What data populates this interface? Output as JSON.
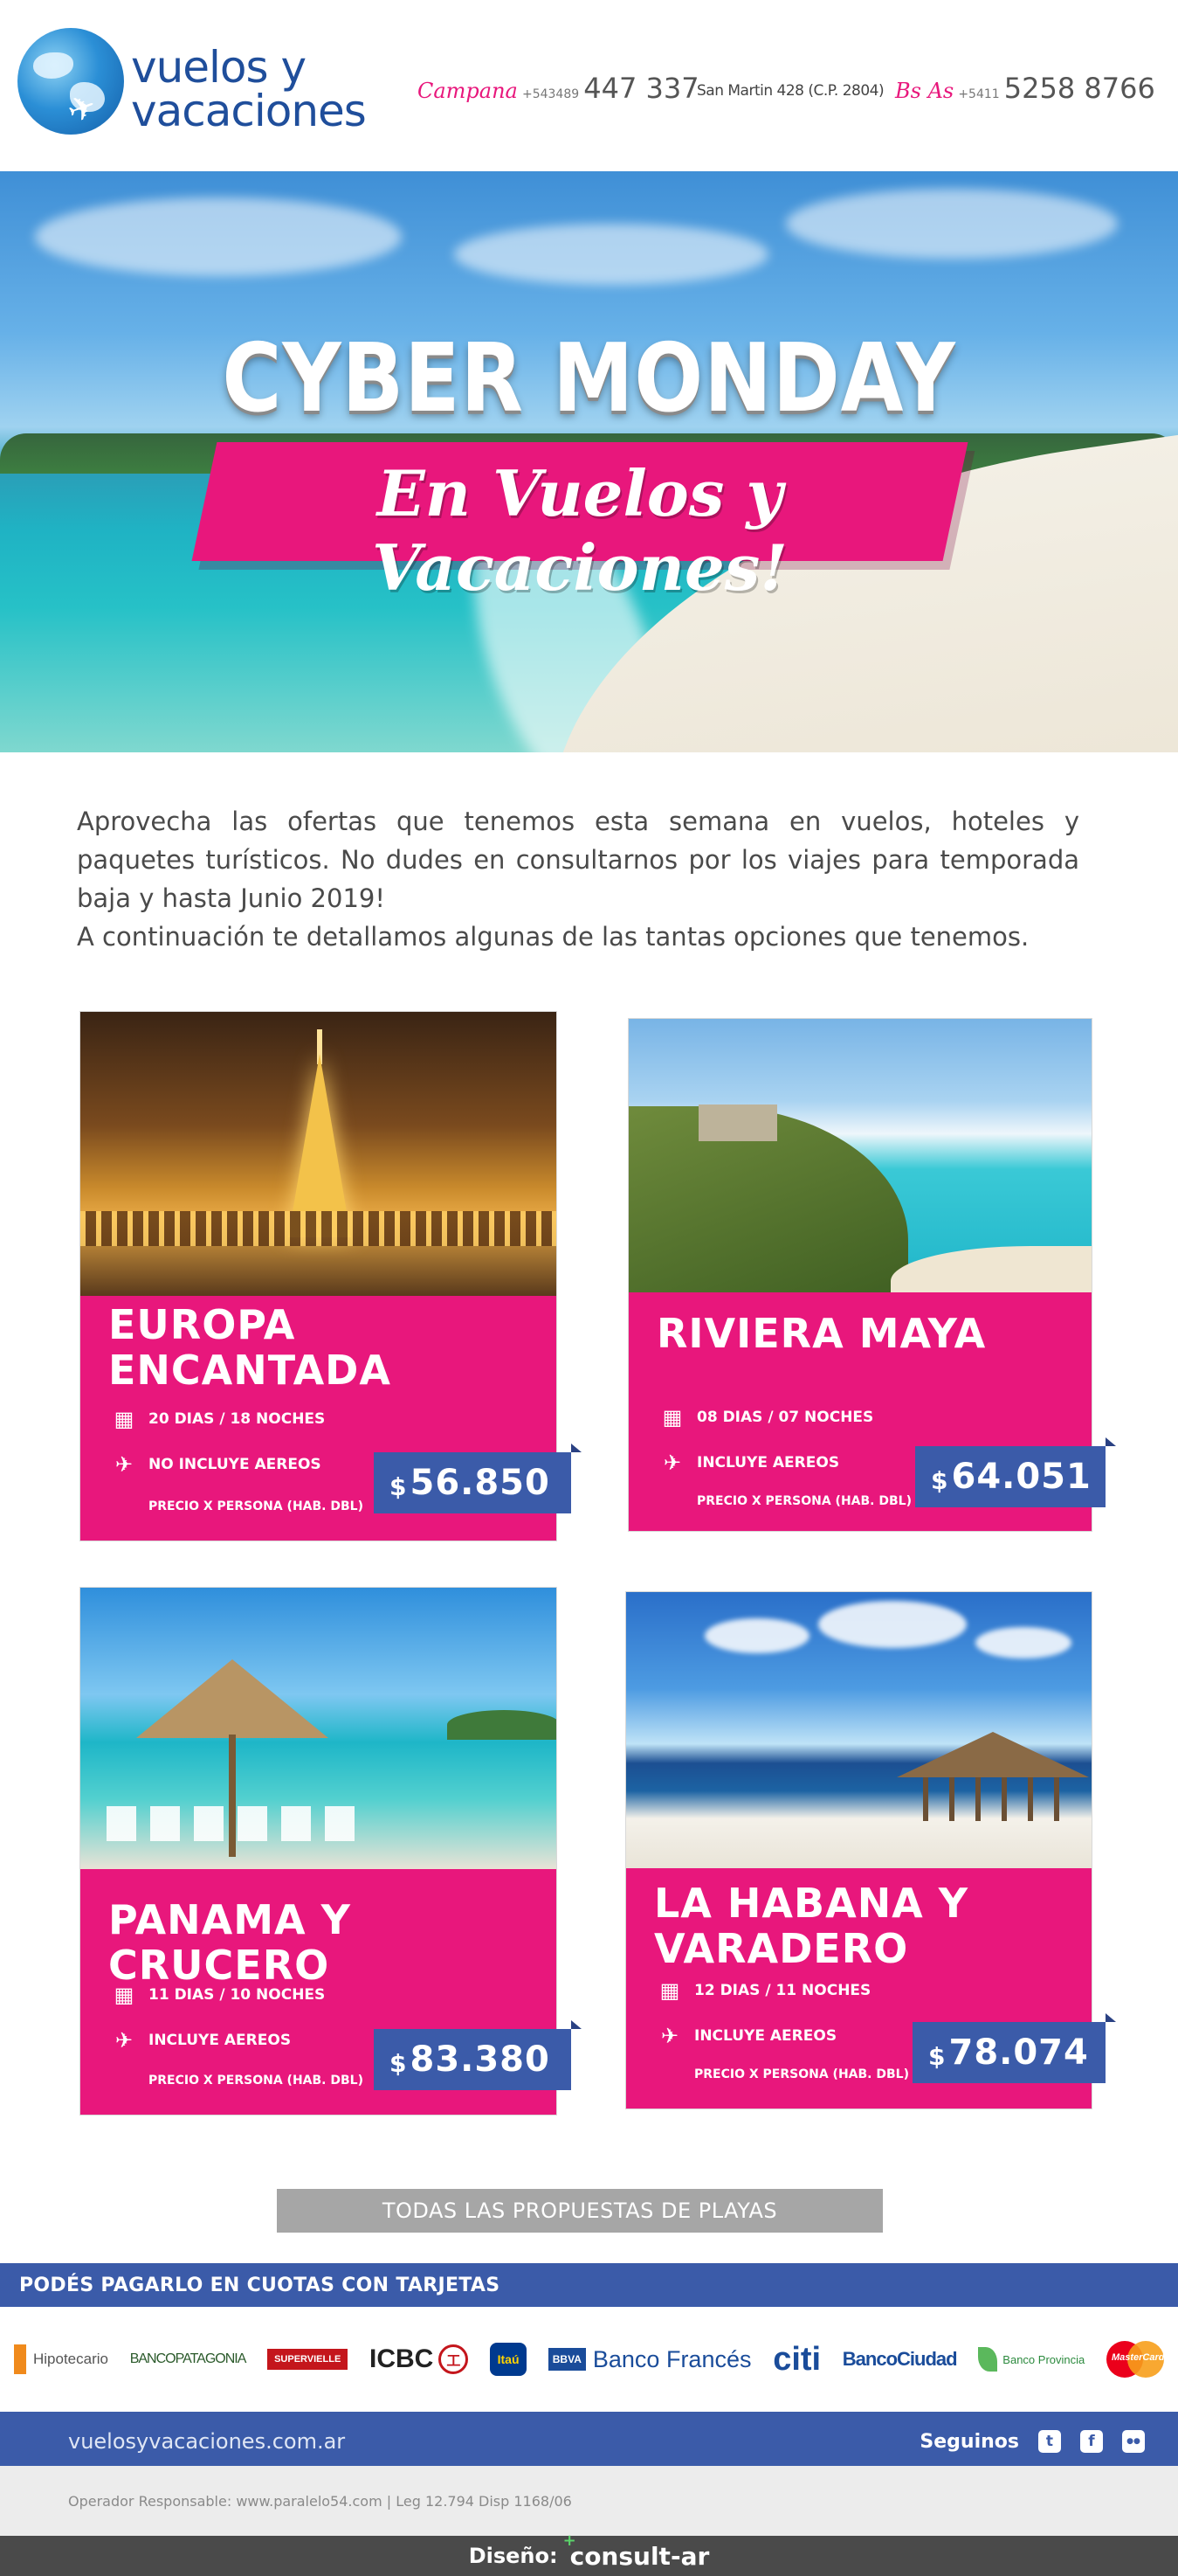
{
  "header": {
    "logo": {
      "line1": "vuelos y",
      "line2": "vacaciones"
    },
    "offices": [
      {
        "city": "Campana",
        "prefix": "+543489",
        "phone": "447 337",
        "address": "San Martin 428 (C.P. 2804)"
      },
      {
        "city": "Bs As",
        "prefix": "+5411",
        "phone": "5258 8766"
      }
    ]
  },
  "hero": {
    "title": "CYBER MONDAY",
    "subtitle": "En Vuelos y Vacaciones!"
  },
  "intro": {
    "paragraph1": "Aprovecha las ofertas que tenemos esta semana en vuelos, hoteles y paquetes turísticos. No dudes en consultarnos por los viajes para temporada baja y hasta Junio 2019!",
    "paragraph2": "A continuación te detallamos algunas de las tantas opciones que tenemos."
  },
  "packages": [
    {
      "name_line1": "EUROPA",
      "name_line2": "ENCANTADA",
      "duration": "20 DIAS / 18 NOCHES",
      "flights": "NO INCLUYE AEREOS",
      "note": "PRECIO X PERSONA (HAB. DBL)",
      "currency": "$",
      "price": "56.850",
      "photo": "paris-eiffel-tower-night"
    },
    {
      "name_line1": "RIVIERA MAYA",
      "name_line2": "",
      "duration": "08 DIAS / 07 NOCHES",
      "flights": "INCLUYE AEREOS",
      "note": "PRECIO X PERSONA (HAB. DBL)",
      "currency": "$",
      "price": "64.051",
      "photo": "tulum-ruins-beach"
    },
    {
      "name_line1": "PANAMA Y CRUCERO",
      "name_line2": "",
      "duration": "11 DIAS / 10 NOCHES",
      "flights": "INCLUYE AEREOS",
      "note": "PRECIO X PERSONA (HAB. DBL)",
      "currency": "$",
      "price": "83.380",
      "photo": "beach-umbrella-chairs"
    },
    {
      "name_line1": "LA HABANA Y",
      "name_line2": "VARADERO",
      "duration": "12 DIAS / 11 NOCHES",
      "flights": "INCLUYE AEREOS",
      "note": "PRECIO X PERSONA (HAB. DBL)",
      "currency": "$",
      "price": "78.074",
      "photo": "varadero-beach-hut"
    }
  ],
  "icons": {
    "duration": "calendar-icon",
    "flights": "airplane-icon"
  },
  "cta": {
    "label": "TODAS LAS PROPUESTAS DE PLAYAS"
  },
  "payment": {
    "title": "PODÉS PAGARLO EN CUOTAS CON  TARJETAS",
    "banks": [
      "Banco Hipotecario",
      "BANCOPATAGONIA",
      "SUPERVIELLE",
      "ICBC",
      "Itaú",
      "BBVA",
      "Banco Francés",
      "citi",
      "Banco Ciudad",
      "Banco Provincia",
      "MasterCard"
    ]
  },
  "bank_labels": {
    "hipotecario": "Hipotecario",
    "patagonia": "BANCOPATAGONIA",
    "supervielle": "SUPERVIELLE",
    "icbc": "ICBC",
    "icbc_seal": "工",
    "itau": "Itaú",
    "bbva": "BBVA",
    "frances": "Banco Francés",
    "citi": "citi",
    "ciudad": "BancoCiudad",
    "provincia": "Banco Provincia",
    "mastercard": "MasterCard"
  },
  "footer": {
    "website": "vuelosyvacaciones.com.ar",
    "follow_label": "Seguinos",
    "social": [
      "twitter",
      "facebook",
      "community"
    ],
    "social_glyphs": {
      "twitter": "t",
      "facebook": "f",
      "community": "●●"
    },
    "legal": "Operador Responsable: www.paralelo54.com  |  Leg 12.794 Disp 1168/06",
    "design_label": "Diseño:",
    "design_brand": "consult-ar",
    "design_plus": "+"
  },
  "colors": {
    "brand_pink": "#e8177c",
    "brand_blue": "#3b5ba9",
    "logo_blue": "#1f4e9b",
    "cta_gray": "#a6a6a6"
  }
}
